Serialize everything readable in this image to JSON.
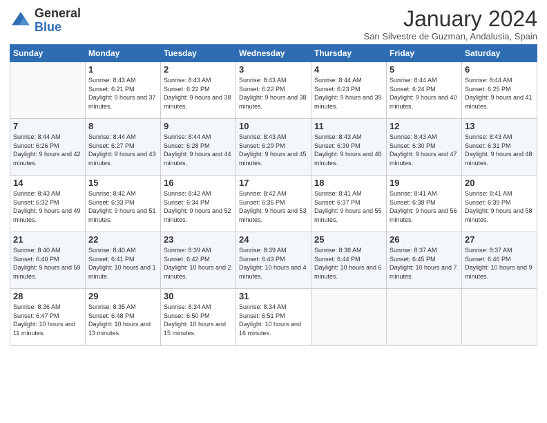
{
  "header": {
    "logo_general": "General",
    "logo_blue": "Blue",
    "month_title": "January 2024",
    "subtitle": "San Silvestre de Guzman, Andalusia, Spain"
  },
  "days_of_week": [
    "Sunday",
    "Monday",
    "Tuesday",
    "Wednesday",
    "Thursday",
    "Friday",
    "Saturday"
  ],
  "weeks": [
    [
      {
        "num": "",
        "empty": true
      },
      {
        "num": "1",
        "sunrise": "Sunrise: 8:43 AM",
        "sunset": "Sunset: 6:21 PM",
        "daylight": "Daylight: 9 hours and 37 minutes."
      },
      {
        "num": "2",
        "sunrise": "Sunrise: 8:43 AM",
        "sunset": "Sunset: 6:22 PM",
        "daylight": "Daylight: 9 hours and 38 minutes."
      },
      {
        "num": "3",
        "sunrise": "Sunrise: 8:43 AM",
        "sunset": "Sunset: 6:22 PM",
        "daylight": "Daylight: 9 hours and 38 minutes."
      },
      {
        "num": "4",
        "sunrise": "Sunrise: 8:44 AM",
        "sunset": "Sunset: 6:23 PM",
        "daylight": "Daylight: 9 hours and 39 minutes."
      },
      {
        "num": "5",
        "sunrise": "Sunrise: 8:44 AM",
        "sunset": "Sunset: 6:24 PM",
        "daylight": "Daylight: 9 hours and 40 minutes."
      },
      {
        "num": "6",
        "sunrise": "Sunrise: 8:44 AM",
        "sunset": "Sunset: 6:25 PM",
        "daylight": "Daylight: 9 hours and 41 minutes."
      }
    ],
    [
      {
        "num": "7",
        "sunrise": "Sunrise: 8:44 AM",
        "sunset": "Sunset: 6:26 PM",
        "daylight": "Daylight: 9 hours and 42 minutes."
      },
      {
        "num": "8",
        "sunrise": "Sunrise: 8:44 AM",
        "sunset": "Sunset: 6:27 PM",
        "daylight": "Daylight: 9 hours and 43 minutes."
      },
      {
        "num": "9",
        "sunrise": "Sunrise: 8:44 AM",
        "sunset": "Sunset: 6:28 PM",
        "daylight": "Daylight: 9 hours and 44 minutes."
      },
      {
        "num": "10",
        "sunrise": "Sunrise: 8:43 AM",
        "sunset": "Sunset: 6:29 PM",
        "daylight": "Daylight: 9 hours and 45 minutes."
      },
      {
        "num": "11",
        "sunrise": "Sunrise: 8:43 AM",
        "sunset": "Sunset: 6:30 PM",
        "daylight": "Daylight: 9 hours and 46 minutes."
      },
      {
        "num": "12",
        "sunrise": "Sunrise: 8:43 AM",
        "sunset": "Sunset: 6:30 PM",
        "daylight": "Daylight: 9 hours and 47 minutes."
      },
      {
        "num": "13",
        "sunrise": "Sunrise: 8:43 AM",
        "sunset": "Sunset: 6:31 PM",
        "daylight": "Daylight: 9 hours and 48 minutes."
      }
    ],
    [
      {
        "num": "14",
        "sunrise": "Sunrise: 8:43 AM",
        "sunset": "Sunset: 6:32 PM",
        "daylight": "Daylight: 9 hours and 49 minutes."
      },
      {
        "num": "15",
        "sunrise": "Sunrise: 8:42 AM",
        "sunset": "Sunset: 6:33 PM",
        "daylight": "Daylight: 9 hours and 51 minutes."
      },
      {
        "num": "16",
        "sunrise": "Sunrise: 8:42 AM",
        "sunset": "Sunset: 6:34 PM",
        "daylight": "Daylight: 9 hours and 52 minutes."
      },
      {
        "num": "17",
        "sunrise": "Sunrise: 8:42 AM",
        "sunset": "Sunset: 6:36 PM",
        "daylight": "Daylight: 9 hours and 53 minutes."
      },
      {
        "num": "18",
        "sunrise": "Sunrise: 8:41 AM",
        "sunset": "Sunset: 6:37 PM",
        "daylight": "Daylight: 9 hours and 55 minutes."
      },
      {
        "num": "19",
        "sunrise": "Sunrise: 8:41 AM",
        "sunset": "Sunset: 6:38 PM",
        "daylight": "Daylight: 9 hours and 56 minutes."
      },
      {
        "num": "20",
        "sunrise": "Sunrise: 8:41 AM",
        "sunset": "Sunset: 6:39 PM",
        "daylight": "Daylight: 9 hours and 58 minutes."
      }
    ],
    [
      {
        "num": "21",
        "sunrise": "Sunrise: 8:40 AM",
        "sunset": "Sunset: 6:40 PM",
        "daylight": "Daylight: 9 hours and 59 minutes."
      },
      {
        "num": "22",
        "sunrise": "Sunrise: 8:40 AM",
        "sunset": "Sunset: 6:41 PM",
        "daylight": "Daylight: 10 hours and 1 minute."
      },
      {
        "num": "23",
        "sunrise": "Sunrise: 8:39 AM",
        "sunset": "Sunset: 6:42 PM",
        "daylight": "Daylight: 10 hours and 2 minutes."
      },
      {
        "num": "24",
        "sunrise": "Sunrise: 8:39 AM",
        "sunset": "Sunset: 6:43 PM",
        "daylight": "Daylight: 10 hours and 4 minutes."
      },
      {
        "num": "25",
        "sunrise": "Sunrise: 8:38 AM",
        "sunset": "Sunset: 6:44 PM",
        "daylight": "Daylight: 10 hours and 6 minutes."
      },
      {
        "num": "26",
        "sunrise": "Sunrise: 8:37 AM",
        "sunset": "Sunset: 6:45 PM",
        "daylight": "Daylight: 10 hours and 7 minutes."
      },
      {
        "num": "27",
        "sunrise": "Sunrise: 8:37 AM",
        "sunset": "Sunset: 6:46 PM",
        "daylight": "Daylight: 10 hours and 9 minutes."
      }
    ],
    [
      {
        "num": "28",
        "sunrise": "Sunrise: 8:36 AM",
        "sunset": "Sunset: 6:47 PM",
        "daylight": "Daylight: 10 hours and 11 minutes."
      },
      {
        "num": "29",
        "sunrise": "Sunrise: 8:35 AM",
        "sunset": "Sunset: 6:48 PM",
        "daylight": "Daylight: 10 hours and 13 minutes."
      },
      {
        "num": "30",
        "sunrise": "Sunrise: 8:34 AM",
        "sunset": "Sunset: 6:50 PM",
        "daylight": "Daylight: 10 hours and 15 minutes."
      },
      {
        "num": "31",
        "sunrise": "Sunrise: 8:34 AM",
        "sunset": "Sunset: 6:51 PM",
        "daylight": "Daylight: 10 hours and 16 minutes."
      },
      {
        "num": "",
        "empty": true
      },
      {
        "num": "",
        "empty": true
      },
      {
        "num": "",
        "empty": true
      }
    ]
  ]
}
